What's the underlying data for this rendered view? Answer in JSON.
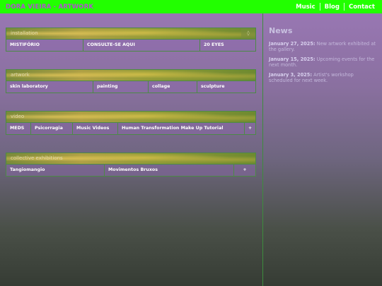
{
  "header": {
    "brand": "DORA VIEIRA - ARTWORK",
    "nav": [
      {
        "label": "Music"
      },
      {
        "label": "Blog"
      },
      {
        "label": "Contact"
      }
    ]
  },
  "sections": [
    {
      "label": "installation",
      "tag": "◊",
      "items": [
        "MISTIFÓRIO",
        "CONSULTE-SE AQUI",
        "20 EYES"
      ]
    },
    {
      "label": "artwork",
      "items": [
        "skin laboratory",
        "painting",
        "collage",
        "sculpture"
      ]
    },
    {
      "label": "video",
      "items": [
        "MEDS",
        "Psicorragia",
        "Music Videos",
        "Human Transformation Make Up Tutorial",
        "+"
      ]
    },
    {
      "label": "collective exhibitions",
      "items": [
        "Tangiomangio",
        "Movimentos Bruxos",
        "+"
      ]
    }
  ],
  "news": {
    "title": "News",
    "items": [
      {
        "date": "January 27, 2025:",
        "text": " New artwork exhibited at the gallery."
      },
      {
        "date": "January 15, 2025:",
        "text": " Upcoming events for the next month."
      },
      {
        "date": "January 3, 2025:",
        "text": " Artist's workshop scheduled for next week."
      }
    ]
  },
  "colors": {
    "accent": "#22ff00",
    "brand": "#b050d0",
    "border": "#4c8a46"
  }
}
